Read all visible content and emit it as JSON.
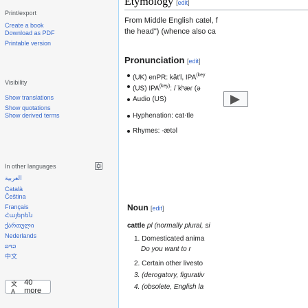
{
  "sidebar": {
    "top_items": [
      {
        "label": "Print/export",
        "type": "heading"
      },
      {
        "label": "Create a book",
        "type": "link"
      },
      {
        "label": "Download as PDF",
        "type": "link"
      },
      {
        "label": "Printable version",
        "type": "link"
      }
    ],
    "visibility": {
      "heading": "Visibility",
      "items": [
        "Show translations",
        "Show quotations",
        "Show derived terms"
      ]
    },
    "languages": {
      "heading": "In other languages",
      "items": [
        "العربية",
        "Català",
        "Čeština",
        "Français",
        "Հայերեն",
        "ქართული",
        "Nederlands",
        "ລາວ",
        "中文"
      ],
      "more_label": "40 more",
      "more_icon": "文A"
    }
  },
  "content": {
    "etymology_heading": "Etymology",
    "etymology_edit": "edit",
    "etymology_text_1": "From Middle English catel, f",
    "etymology_text_2": "the head\") (whence also ca",
    "pronunciation_heading": "Pronunciation",
    "pronunciation_edit": "edit",
    "pron_uk": "(UK) enPR: kăt′l, IPA",
    "pron_uk_sup": "(key",
    "pron_us": "(US) IPA",
    "pron_us_sup": "(key)",
    "pron_us_ipa": ": /ˈkʰæɾ (ə",
    "audio_label": "Audio (US)",
    "hyphenation": "Hyphenation: cat‧tle",
    "rhymes": "Rhymes: -ætəl",
    "noun_heading": "Noun",
    "noun_edit": "edit",
    "headword": "cattle",
    "headword_tail": "pl (normally plural, si",
    "def1": "1. Domesticated anima",
    "def1_example": "Do you want to r",
    "def2": "2. Certain other livesto",
    "def3": "3. (derogatory, figurativ",
    "def4": "4. (obsolete, English la"
  }
}
